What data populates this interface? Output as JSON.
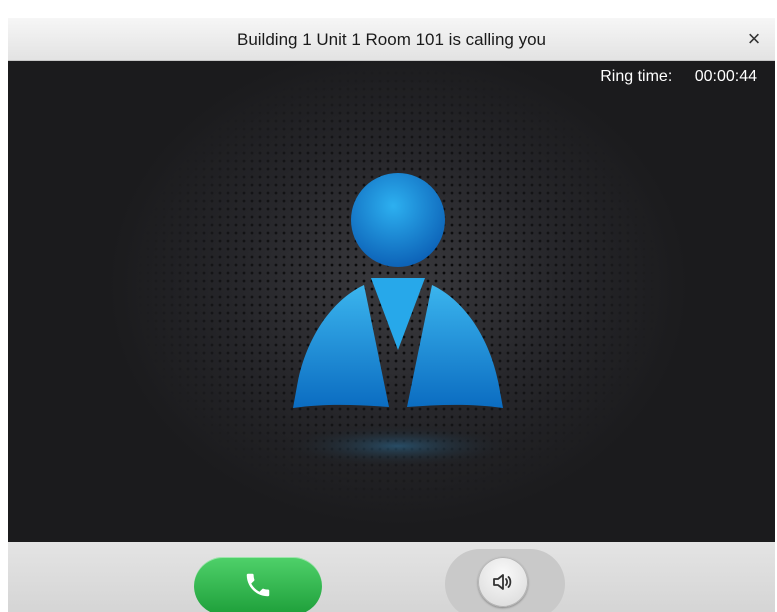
{
  "window": {
    "title": "Building 1 Unit 1 Room 101 is calling you",
    "close_glyph": "×"
  },
  "call": {
    "ring_label": "Ring time:",
    "ring_time": "00:00:44"
  },
  "icons": {
    "close": "close-icon",
    "caller_avatar": "person-icon",
    "answer": "phone-icon",
    "speaker": "speaker-icon"
  },
  "colors": {
    "answer_button": "#2bb24a",
    "avatar_blue": "#1585d6",
    "video_background": "#1b1b1d"
  }
}
